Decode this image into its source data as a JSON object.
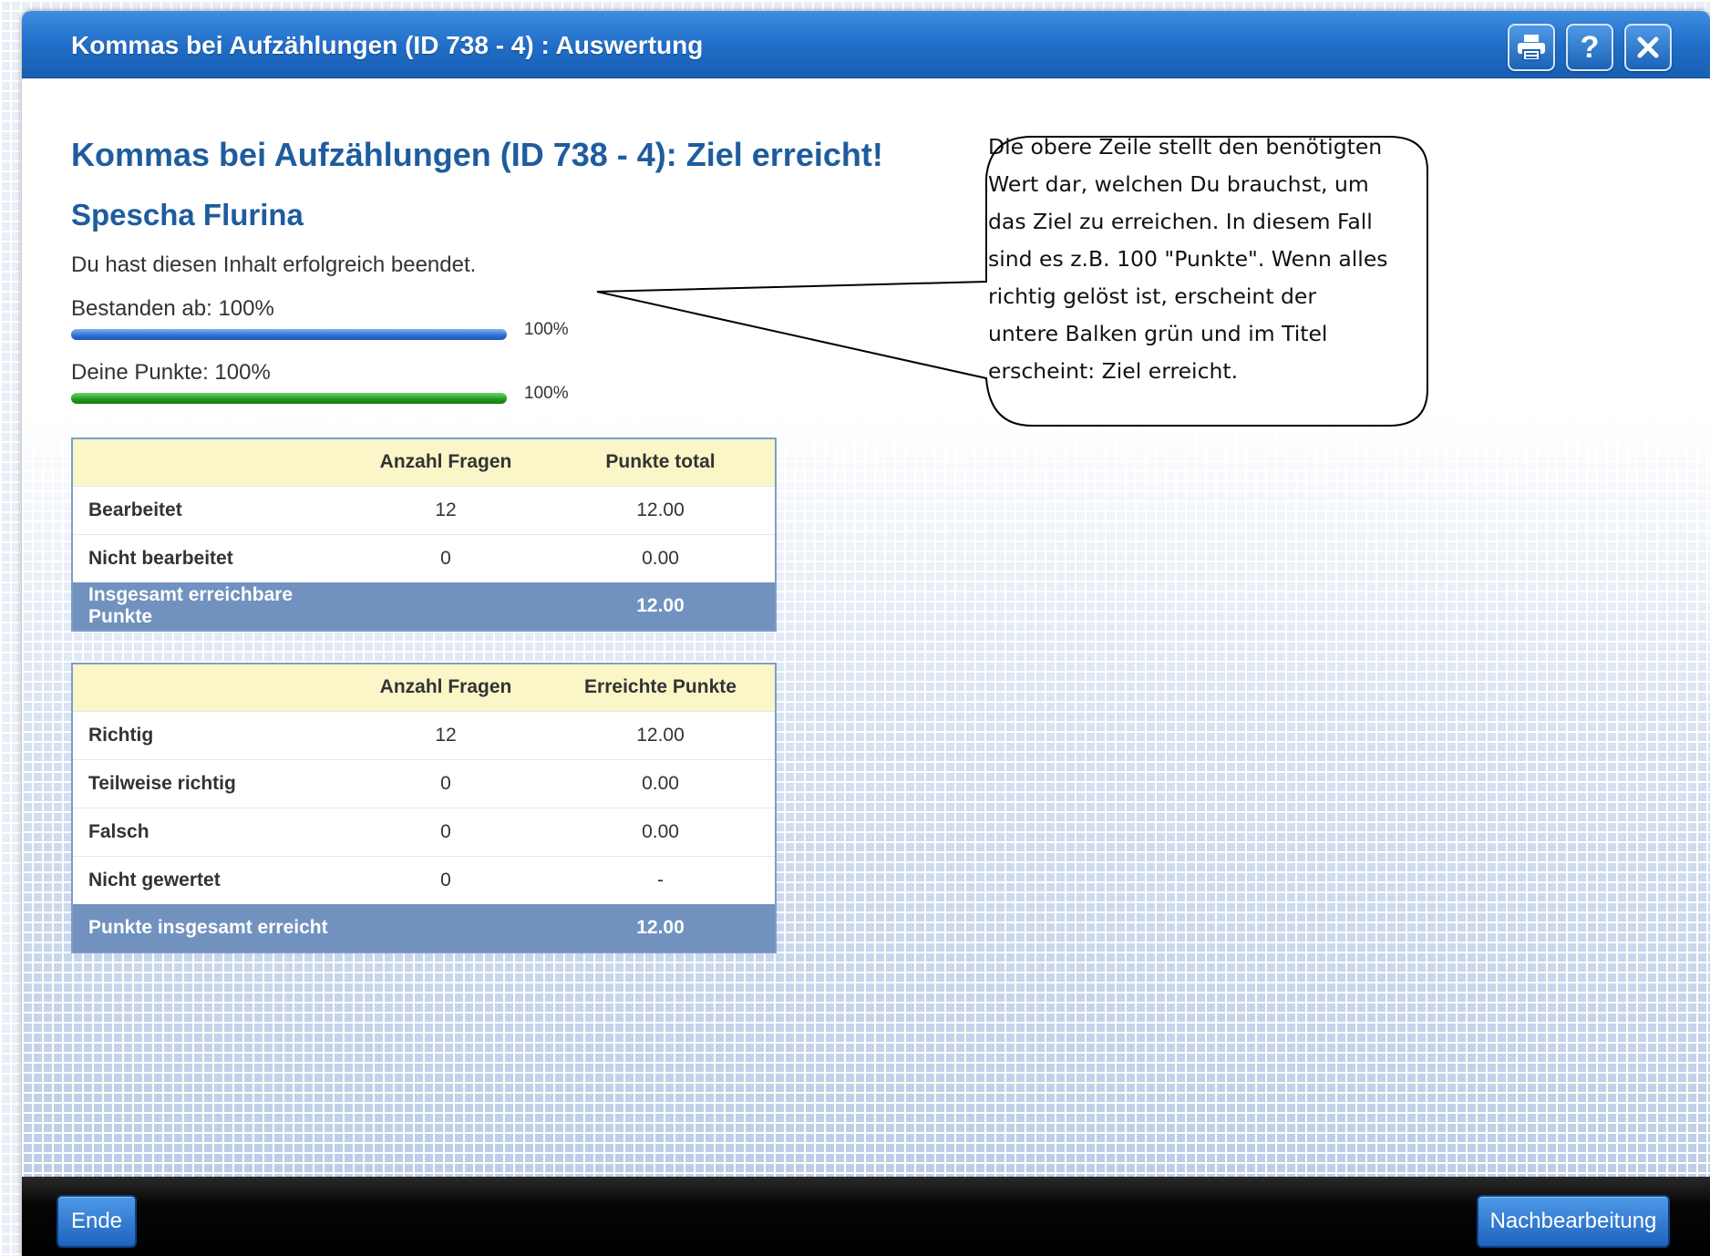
{
  "window": {
    "title": "Kommas bei Aufzählungen (ID 738 - 4) : Auswertung",
    "buttons": {
      "print": "print-icon",
      "help": "?",
      "close": "close-icon"
    }
  },
  "result": {
    "heading": "Kommas bei Aufzählungen (ID 738 - 4): Ziel erreicht!",
    "student_name": "Spescha Flurina",
    "message": "Du hast diesen Inhalt erfolgreich beendet.",
    "pass_threshold": {
      "label": "Bestanden ab: 100%",
      "percent_label": "100%",
      "fill_percent": 100,
      "color": "#2e6fd0"
    },
    "your_score": {
      "label": "Deine Punkte: 100%",
      "percent_label": "100%",
      "fill_percent": 100,
      "color": "#1d9a1d"
    }
  },
  "table_processed": {
    "headers": [
      "",
      "Anzahl Fragen",
      "Punkte total"
    ],
    "rows": [
      [
        "Bearbeitet",
        "12",
        "12.00"
      ],
      [
        "Nicht bearbeitet",
        "0",
        "0.00"
      ]
    ],
    "total": [
      "Insgesamt erreichbare Punkte",
      "",
      "12.00"
    ]
  },
  "table_results": {
    "headers": [
      "",
      "Anzahl Fragen",
      "Erreichte Punkte"
    ],
    "rows": [
      [
        "Richtig",
        "12",
        "12.00"
      ],
      [
        "Teilweise richtig",
        "0",
        "0.00"
      ],
      [
        "Falsch",
        "0",
        "0.00"
      ],
      [
        "Nicht gewertet",
        "0",
        "-"
      ]
    ],
    "total": [
      "Punkte insgesamt erreicht",
      "",
      "12.00"
    ]
  },
  "callout": {
    "lines": [
      "Die obere Zeile stellt den benötigten",
      "Wert dar, welchen Du brauchst, um",
      "das Ziel zu erreichen. In diesem Fall",
      "sind es z.B. 100 \"Punkte\". Wenn alles",
      "richtig gelöst ist, erscheint der",
      "untere Balken grün und im Titel",
      "erscheint: Ziel erreicht."
    ]
  },
  "footer": {
    "end_label": "Ende",
    "review_label": "Nachbearbeitung"
  },
  "colors": {
    "titlebar": "#1f6cc6",
    "heading": "#1e5c9e",
    "table_header": "#fbf6c8",
    "table_total": "#7192bf"
  }
}
